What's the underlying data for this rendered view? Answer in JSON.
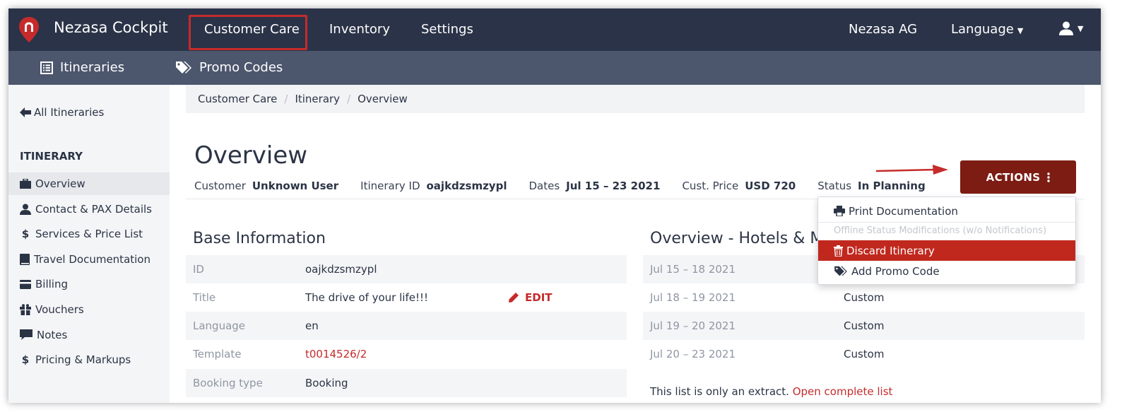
{
  "app": {
    "brand": "Nezasa Cockpit",
    "colors": {
      "nav": "#2b3348",
      "subnav": "#4c566d",
      "accent": "#c62b2b",
      "actions": "#7c1c13"
    }
  },
  "topnav": {
    "items": [
      "Customer Care",
      "Inventory",
      "Settings"
    ],
    "company": "Nezasa AG",
    "language": "Language"
  },
  "subnav": {
    "items": [
      {
        "label": "Itineraries",
        "icon": "list-icon"
      },
      {
        "label": "Promo Codes",
        "icon": "tags-icon"
      }
    ]
  },
  "sidebar": {
    "back": "All Itineraries",
    "heading": "ITINERARY",
    "items": [
      {
        "label": "Overview",
        "icon": "briefcase-icon"
      },
      {
        "label": "Contact & PAX Details",
        "icon": "user-icon"
      },
      {
        "label": "Services & Price List",
        "icon": "dollar-icon"
      },
      {
        "label": "Travel Documentation",
        "icon": "book-icon"
      },
      {
        "label": "Billing",
        "icon": "credit-card-icon"
      },
      {
        "label": "Vouchers",
        "icon": "gift-icon"
      },
      {
        "label": "Notes",
        "icon": "comment-icon"
      },
      {
        "label": "Pricing & Markups",
        "icon": "dollar-icon"
      }
    ]
  },
  "breadcrumb": [
    "Customer Care",
    "Itinerary",
    "Overview"
  ],
  "page": {
    "title": "Overview",
    "summary": [
      {
        "label": "Customer",
        "value": "Unknown User"
      },
      {
        "label": "Itinerary ID",
        "value": "oajkdzsmzypl"
      },
      {
        "label": "Dates",
        "value": "Jul 15 – 23 2021"
      },
      {
        "label": "Cust. Price",
        "value": "USD 720"
      },
      {
        "label": "Status",
        "value": "In Planning"
      }
    ],
    "actions_label": "ACTIONS"
  },
  "actions_menu": {
    "print": "Print Documentation",
    "offline_header": "Offline Status Modifications (w/o Notifications)",
    "discard": "Discard Itinerary",
    "promo": "Add Promo Code"
  },
  "base_info": {
    "title": "Base Information",
    "edit_label": "EDIT",
    "rows": [
      {
        "key": "ID",
        "value": "oajkdzsmzypl"
      },
      {
        "key": "Title",
        "value": "The drive of your life!!!"
      },
      {
        "key": "Language",
        "value": "en"
      },
      {
        "key": "Template",
        "value": "t0014526/2"
      },
      {
        "key": "Booking type",
        "value": "Booking"
      }
    ]
  },
  "hotels": {
    "title": "Overview - Hotels & M",
    "rows": [
      {
        "dates": "Jul 15 – 18 2021",
        "type": ""
      },
      {
        "dates": "Jul 18 – 19 2021",
        "type": "Custom"
      },
      {
        "dates": "Jul 19 – 20 2021",
        "type": "Custom"
      },
      {
        "dates": "Jul 20 – 23 2021",
        "type": "Custom"
      }
    ],
    "extract_text": "This list is only an extract.",
    "extract_link": "Open complete list"
  }
}
